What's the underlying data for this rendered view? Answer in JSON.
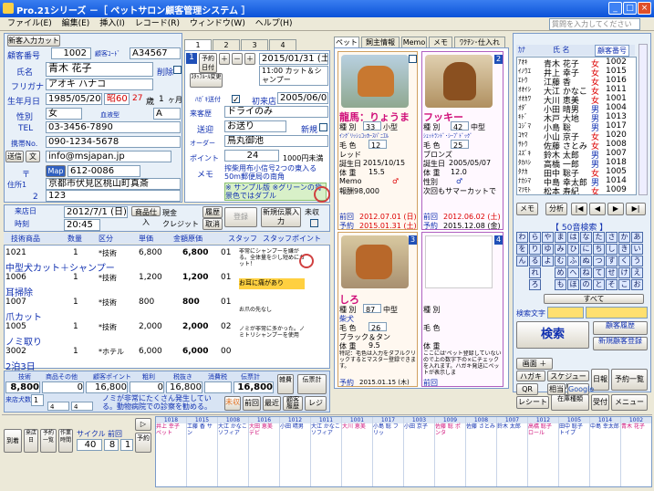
{
  "window": {
    "title": "Pro.21シリーズ  －［ ペットサロン顧客管理システム ］",
    "controls": [
      "_",
      "□",
      "×"
    ]
  },
  "menu": [
    "ファイル(E)",
    "編集(E)",
    "挿入(I)",
    "レコード(R)",
    "ウィンドウ(W)",
    "ヘルプ(H)"
  ],
  "help_placeholder": "質問を入力してください",
  "customer": {
    "register_btn": "新客入力カット",
    "code_label": "顧客番号",
    "code": "1002",
    "ext_label": "顧客ｺｰﾄﾞ",
    "ext_code": "A34567",
    "name_label": "氏名",
    "name": "青木  花子",
    "delete_label": "削除",
    "kana_label": "フリガナ",
    "kana": "アオキ ハナコ",
    "birth_label": "生年月日",
    "birth": "1985/05/20",
    "era": "昭60",
    "age": "27",
    "age_unit": "歳",
    "months": "1",
    "month_unit": "ヶ月",
    "sex_label": "性別",
    "sex": "女",
    "blood_label": "血液型",
    "blood": "A",
    "tel_label": "TEL",
    "tel": "03-3456-7890",
    "mobile_label": "携帯No.",
    "mobile": "090-1234-5678",
    "send_btn": "送信",
    "doc_btn": "文",
    "email": "info@msjapan.jp",
    "zip_label": "〒",
    "map_btn": "Map",
    "zip": "612-0086",
    "addr1_label": "住所1",
    "addr1": "京都市伏見区桃山町真斎",
    "addr2_label": "2",
    "addr2": "123"
  },
  "tabs": [
    "1",
    "2",
    "3",
    "4"
  ],
  "visit": {
    "reserve_btn": "予約日付",
    "date": "2015/01/31 (土)",
    "service": "11:00 カット＆シャンプー",
    "staff_btn": "ｽﾀｯﾌﾙｰﾙ変更",
    "dm_label": "ﾊｶﾞｷ送付",
    "dm_chk": "✓",
    "first_label": "初来店",
    "first": "2005/06/05",
    "job_label": "来客歴",
    "job": "ドライのみ",
    "send_label": "送迎",
    "send": "お送り",
    "new_label": "新規",
    "order_label": "オーダー",
    "order": "鳥丸御池",
    "point_label": "ポイント",
    "point": "24",
    "point_note": "1000円未満",
    "memo_label": "メモ",
    "memo": "搾柴用布小信号2つの東入る50m郵便局の南角"
  },
  "sample": {
    "text": "※ サンプル版 ※グリーンの背景色ではダブル"
  },
  "payment": {
    "visit_label": "来店日",
    "visit_date": "2012/7/1 (日)",
    "time_label": "時刻",
    "time": "20:45",
    "cash_label": "現金",
    "credit_label": "クレジット",
    "shop_btn": "商品仕入",
    "history_btn": "履歴",
    "edit_btn": "追加",
    "cancel_btn": "取消",
    "register_btn": "登録",
    "new_btn": "新規伝票入力",
    "unsettled": "未収"
  },
  "lines": {
    "headers": [
      "技術商品",
      "数量",
      "区分",
      "単価",
      "金額原価",
      "スタッフ",
      "スタッフポイント",
      "粗利"
    ],
    "rows": [
      {
        "code": "1021",
        "qty": "1",
        "kind": "*技術",
        "price": "6,800",
        "amount": "6,800",
        "staff": "01",
        "pt": "5",
        "name": "中型犬カット＋シャンプー",
        "note": "非常にシャンプーを嫌がる。全体量を少し短めにカット！"
      },
      {
        "code": "1006",
        "qty": "1",
        "kind": "*技術",
        "price": "1,200",
        "amount": "1,200",
        "staff": "01",
        "pt": "1",
        "name": "耳掃除",
        "note": "お耳に痛があり"
      },
      {
        "code": "1007",
        "qty": "1",
        "kind": "*技術",
        "price": "800",
        "amount": "800",
        "staff": "01",
        "pt": "",
        "name": "爪カット",
        "note": "お爪の先なし"
      },
      {
        "code": "1005",
        "qty": "1",
        "kind": "*技術",
        "price": "2,000",
        "amount": "2,000",
        "staff": "02",
        "pt": "",
        "name": "ノミ取り",
        "note": "ノミが非常に多かった。ノミトリシャンプーを使用"
      },
      {
        "code": "3002",
        "qty": "1",
        "kind": "*ホテル",
        "price": "6,000",
        "amount": "6,000",
        "staff": "00",
        "pt": "",
        "name": "2泊3日",
        "note": ""
      }
    ]
  },
  "totals": {
    "headers": [
      "技術",
      "商品その他",
      "顧客ポイント",
      "粗利",
      "税抜き",
      "消費税",
      "伝票計",
      "雑費",
      "伝票計"
    ],
    "values": [
      "8,800",
      "0",
      "16,800",
      "0",
      "16,800",
      "",
      "16,800"
    ],
    "dog_label": "来店犬数",
    "dog_count": "1",
    "counts": [
      "4",
      "4"
    ],
    "memo": "ノミが非常にたくさん発生している。動物病院での診察を勧める。",
    "prev_btn": "前回",
    "recent_btn": "最近",
    "history_btn": "顧客履歴",
    "register_btn": "レジ",
    "unsettled_btn": "未収"
  },
  "pets": {
    "tabs": [
      "ペット",
      "飼主情報",
      "Memo",
      "メモ",
      "ﾜｸﾁﾝ･仕入れ"
    ],
    "items": [
      {
        "no": "1",
        "name": "龍馬：りょうま",
        "breed_label": "種  別",
        "breed": "33",
        "size": "小型",
        "breed_name": "ｲﾝｸﾞﾘｯｼｭｺｯｶｰｽﾊﾟﾆｴﾙ",
        "color_label": "毛  色",
        "color": "12",
        "color_name": "レッド",
        "birth_label": "誕生日",
        "birth": "2015/10/15",
        "weight_label": "体  重",
        "weight": "15.5",
        "sex_label": "Memo",
        "sex": "♂",
        "memo": "報酬98,000",
        "last_label": "前回",
        "last": "2012.07.01 (日)",
        "next_label": "予約",
        "next": "2015.01.31 (土)"
      },
      {
        "no": "2",
        "name": "フッキー",
        "breed_label": "種  別",
        "breed": "42",
        "size": "中型",
        "breed_name": "ｼｪｯﾄﾗﾝﾄﾞ･ｼｰﾌﾟﾄﾞｯｸﾞ",
        "color_label": "毛  色",
        "color": "25",
        "color_name": "ブロンズ",
        "birth_label": "誕生日",
        "birth": "2005/05/07",
        "weight_label": "体  重",
        "weight": "12.0",
        "sex_label": "性別",
        "sex": "♂",
        "memo": "次回もサマーカットで",
        "last_label": "前回",
        "last": "2012.06.02 (土)",
        "next_label": "予約",
        "next": "2015.12.08 (金)"
      },
      {
        "no": "3",
        "name": "しろ",
        "breed_label": "種  別",
        "breed": "87",
        "size": "中型",
        "breed_name": "柴犬",
        "color_label": "毛  色",
        "color": "26",
        "color_name": "ブラック＆タン",
        "birth_label": "誕生日",
        "birth": "",
        "weight_label": "体  重",
        "weight": "9.5",
        "sex_label": "Memo",
        "sex": "♂",
        "memo": "特記：毛色は入力をダブルクリックするとマスター登録できます。",
        "last_label": "前回",
        "last": "",
        "next_label": "予約",
        "next": "2015.01.15 (木)"
      },
      {
        "no": "4",
        "name": "",
        "breed_label": "種  別",
        "breed": "",
        "size": "",
        "breed_name": "",
        "color_label": "毛  色",
        "color": "",
        "color_name": "",
        "birth_label": "誕生日",
        "birth": "",
        "weight_label": "体  重",
        "weight": "",
        "sex_label": "Memo",
        "sex": "",
        "memo": "ここには'ペット登録していないので上の数字下の×にチェックを入れます。ハガキ発送にペットが表示しま",
        "last_label": "前回",
        "last": "",
        "next_label": "予約",
        "next": ""
      }
    ]
  },
  "search": {
    "headers": [
      "ｶﾅ",
      "氏  名",
      "顧客番号"
    ],
    "rows": [
      [
        "ｱｵｷ",
        "青木 花子",
        "女",
        "1002"
      ],
      [
        "ｲﾉｳｴ",
        "井上 幸子",
        "女",
        "1015"
      ],
      [
        "ｴﾄｳ",
        "江藤 香",
        "女",
        "1016"
      ],
      [
        "ｵｵｲｼ",
        "大江 かなこ",
        "女",
        "1011"
      ],
      [
        "ｵｵｶﾜ",
        "大川 恵美",
        "女",
        "1001"
      ],
      [
        "ｵﾀﾞ",
        "小田 晴男",
        "男",
        "1004"
      ],
      [
        "ｷﾄﾞ",
        "木戸 大地",
        "男",
        "1013"
      ],
      [
        "ｺｼﾞﾏ",
        "小島 聡",
        "男",
        "1017"
      ],
      [
        "ｺﾔﾏ",
        "小山 京子",
        "女",
        "1020"
      ],
      [
        "ｻﾄｳ",
        "佐藤 さとみ",
        "女",
        "1008"
      ],
      [
        "ｽｽﾞｷ",
        "鈴木 太郎",
        "男",
        "1007"
      ],
      [
        "ﾀｶﾊｼ",
        "高橋 一郎",
        "男",
        "1018"
      ],
      [
        "ﾀﾅｶ",
        "田中 聡子",
        "女",
        "1005"
      ],
      [
        "ﾅｶｼﾏ",
        "中島 幸太郎",
        "男",
        "1014"
      ],
      [
        "ﾏﾂﾓﾄ",
        "松本 寿紀",
        "女",
        "1009"
      ]
    ],
    "memo_btn": "メモ",
    "analysis_btn": "分析",
    "kana_title": "【 50音検索 】",
    "kana": [
      "わ",
      "ら",
      "や",
      "ま",
      "は",
      "な",
      "た",
      "さ",
      "か",
      "あ",
      "を",
      "り",
      "ゆ",
      "み",
      "ひ",
      "に",
      "ち",
      "し",
      "き",
      "い",
      "ん",
      "る",
      "よ",
      "む",
      "ふ",
      "ぬ",
      "つ",
      "す",
      "く",
      "う",
      "",
      "れ",
      "",
      "め",
      "へ",
      "ね",
      "て",
      "せ",
      "け",
      "え",
      "",
      "ろ",
      "",
      "も",
      "ほ",
      "の",
      "と",
      "そ",
      "こ",
      "お"
    ],
    "all_btn": "すべて",
    "search_label": "検索文字",
    "search_btn": "検索",
    "history_btn": "顧客履歴",
    "new_btn": "新規顧客登録",
    "menu_btn": "画面 ＋",
    "hagaki_btn": "ハガキ",
    "schedule_btn": "スケジュール",
    "daily_btn": "日報",
    "reserve_btn": "予約一覧",
    "qr_btn": "QR",
    "photo_btn": "相当",
    "google_btn": "Google",
    "receipt_btn": "レシート",
    "stock_btn": "在庫種類",
    "disp_btn": "受付",
    "menu2_btn": "メニュー"
  },
  "bottom": {
    "icons": [
      "到着",
      "来店日",
      "予約一覧",
      "作業時間"
    ],
    "cycle_label": "サイクル",
    "cycle": "40",
    "prev_label": "前回",
    "prev": "8",
    "next": "1",
    "reserve_btn": "予約",
    "calendar": [
      {
        "code": "1018",
        "name": "井上 幸子 ペット"
      },
      {
        "code": "1015",
        "name": "工藤 香 サン"
      },
      {
        "code": "1008",
        "name": "大江 かなこ ソフィア"
      },
      {
        "code": "1016",
        "name": "大田 恵美 デビ"
      },
      {
        "code": "1012",
        "name": "小田 晴男"
      },
      {
        "code": "1011",
        "name": "大江 かなこ ソフィア"
      },
      {
        "code": "1001",
        "name": "大川 恵美"
      },
      {
        "code": "1017",
        "name": "小島 聡 フリッ"
      },
      {
        "code": "1003",
        "name": "小田 京子"
      },
      {
        "code": "1009",
        "name": "佐藤 聡 ポンタ"
      },
      {
        "code": "1008",
        "name": "佐藤 さとみ"
      },
      {
        "code": "1007",
        "name": "鈴木 太郎"
      },
      {
        "code": "1012",
        "name": "高橋 聡子 ロール"
      },
      {
        "code": "1005",
        "name": "田中 聡子 トイプ"
      },
      {
        "code": "1014",
        "name": "中島 幸太郎"
      },
      {
        "code": "1002",
        "name": "青木 花子"
      }
    ]
  }
}
